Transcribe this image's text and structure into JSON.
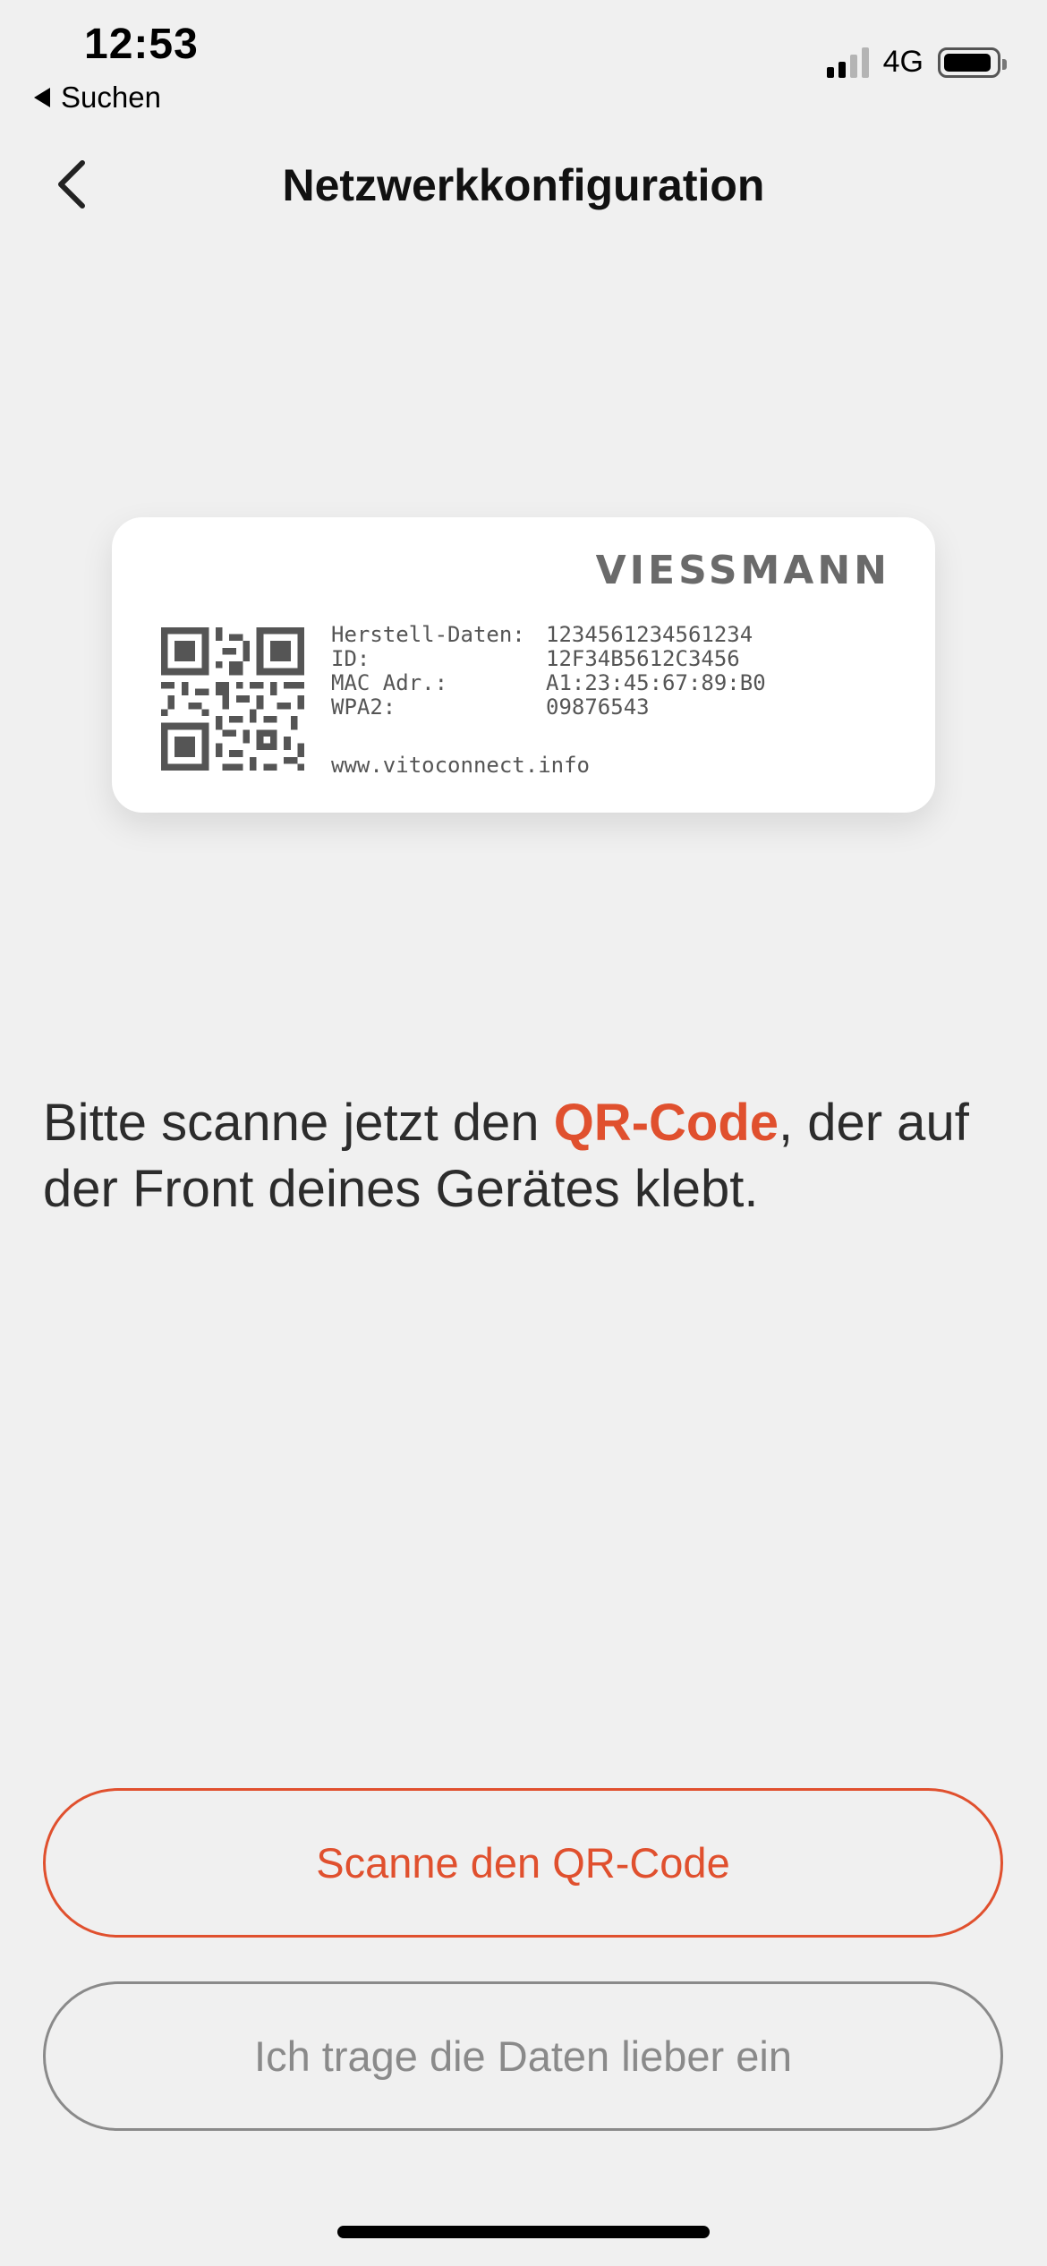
{
  "status_bar": {
    "time": "12:53",
    "back_app": "Suchen",
    "network": "4G",
    "signal_bars_active": 2,
    "signal_bars_total": 4
  },
  "nav": {
    "title": "Netzwerkkonfiguration",
    "back_icon": "chevron-left-icon"
  },
  "card": {
    "brand": "VIESSMANN",
    "qr_icon": "qr-code-icon",
    "fields": [
      {
        "key": "Herstell-Daten:",
        "value": "1234561234561234"
      },
      {
        "key": "ID:",
        "value": "12F34B5612C3456"
      },
      {
        "key": "MAC Adr.:",
        "value": "A1:23:45:67:89:B0"
      },
      {
        "key": "WPA2:",
        "value": "09876543"
      }
    ],
    "url": "www.vitoconnect.info"
  },
  "instruction": {
    "before": "Bitte scanne jetzt den ",
    "highlight": "QR-Code",
    "after": ", der auf der Front deines Gerätes klebt."
  },
  "buttons": {
    "scan_label": "Scanne den QR-Code",
    "manual_label": "Ich trage die Daten lieber ein"
  },
  "colors": {
    "accent": "#e0502e",
    "secondary": "#8a8a8a",
    "background": "#f0f0f0"
  }
}
